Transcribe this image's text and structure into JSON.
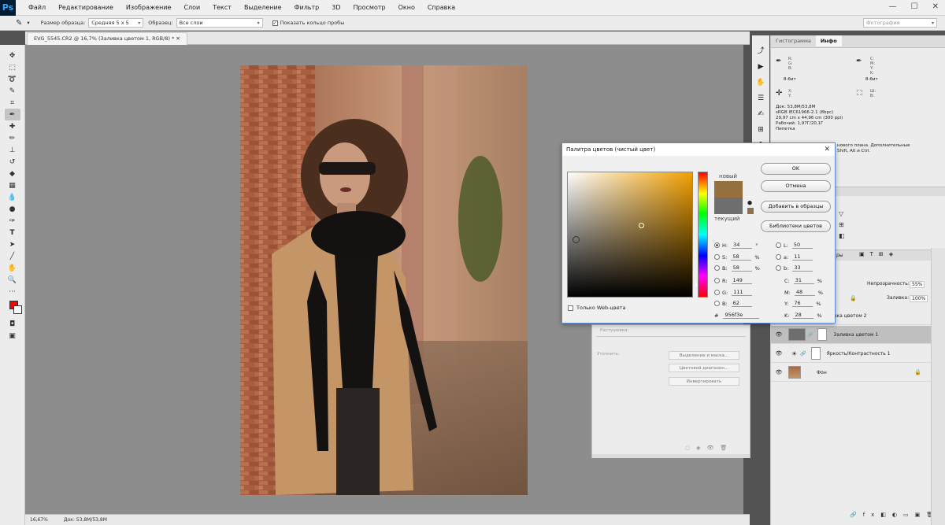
{
  "app": {
    "logo": "Ps"
  },
  "menu": [
    "Файл",
    "Редактирование",
    "Изображение",
    "Слои",
    "Текст",
    "Выделение",
    "Фильтр",
    "3D",
    "Просмотр",
    "Окно",
    "Справка"
  ],
  "options": {
    "sample_size_label": "Размер образца:",
    "sample_size_value": "Средняя 5 x 5",
    "sample_label": "Образец:",
    "sample_value": "Все слои",
    "show_ring_label": "Показать кольцо пробы",
    "workspace": "Фотография"
  },
  "document": {
    "tab": "EVG_5545.CR2 @ 16,7% (Заливка цветом 1, RGB/8) *"
  },
  "status": {
    "zoom": "16,67%",
    "doc": "Док: 53,8M/53,8M"
  },
  "panels": {
    "tabs": [
      "Гистограмма",
      "Инфо"
    ],
    "info_lines": [
      "Док: 53,8M/53,8M",
      "sRGB IEC61966-2.1 (8bpc)",
      "29,97 cm x 44,96 cm (300 ppi)",
      "Рабочий: 1,97Г/20,1Г",
      "Пипетка"
    ],
    "info_tip": [
      "нового плана. Дополнительные",
      "Shift, Alt и Ctrl."
    ],
    "bit_left": "8-бит",
    "bit_right": "8-бит",
    "opacity_label": "Непрозрачность:",
    "opacity_value": "55%",
    "fill_label": "Заливка:",
    "fill_value": "100%",
    "layers_tab": "ры"
  },
  "layers": [
    {
      "name": "вка цветом 2"
    },
    {
      "name": "Заливка цветом 1"
    },
    {
      "name": "Яркость/Контрастность 1"
    },
    {
      "name": "Фон"
    }
  ],
  "properties": {
    "feather": "Растушевка:",
    "refine": "Уточнить:",
    "btn_select_mask": "Выделение и маска...",
    "btn_color_range": "Цветовой диапазон...",
    "btn_invert": "Инвертировать"
  },
  "picker": {
    "title": "Палитра цветов (чистый цвет)",
    "new_label": "новый",
    "current_label": "текущий",
    "new_color": "#956f3e",
    "current_color": "#6e6e6e",
    "ok": "OK",
    "cancel": "Отмена",
    "add_swatches": "Добавить в образцы",
    "libraries": "Библиотеки цветов",
    "web_only": "Только Web-цвета",
    "H": "34",
    "S": "58",
    "B": "58",
    "R": "149",
    "G": "111",
    "Bv": "62",
    "L": "50",
    "a": "11",
    "b": "33",
    "C": "31",
    "M": "48",
    "Y": "76",
    "K": "28",
    "hex": "956f3e",
    "deg": "°",
    "pct": "%"
  }
}
